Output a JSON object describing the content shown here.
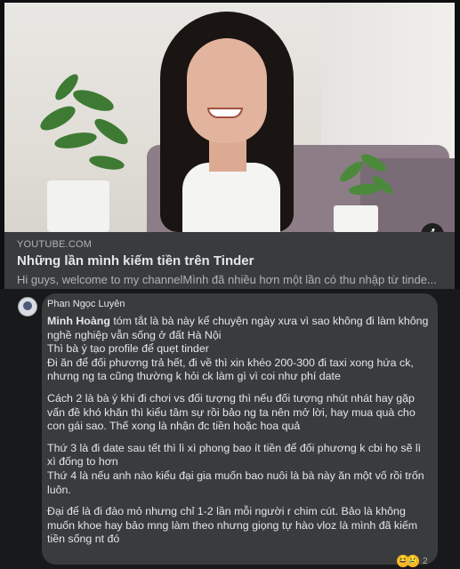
{
  "link_preview": {
    "domain": "YOUTUBE.COM",
    "title": "Những lần mình kiếm tiền trên Tinder",
    "description": "Hi guys, welcome to my channelMình đã nhiều hơn một lần có thu nhập từ tinde...",
    "info_icon": "info-icon"
  },
  "comment": {
    "author": "Phan Ngọc Luyên",
    "mention": "Minh Hoàng",
    "paragraphs": [
      {
        "first_line_rest": " tóm tắt là bà này kể chuyện ngày xưa vì sao không đi làm không nghề nghiệp vẫn sống ở đất Hà Nội",
        "lines": [
          "Thì bà ý tạo profile để quẹt tinder",
          "Đi ăn để đối phương trả hết, đi về thì xin khéo 200-300 đi taxi xong hứa ck, nhưng ng ta cũng thường k hỏi ck làm gì vì coi như phí date"
        ]
      },
      {
        "text": "Cách 2 là bà ý khi đi chơi vs đối tượng thì nếu đối tượng nhút nhát hay gặp vấn đề khó khăn thì kiểu tâm sự rồi bảo ng ta nên mở lời, hay mua quà cho con gái sao. Thế xong là nhận đc tiền hoặc hoa quả"
      },
      {
        "lines": [
          "Thứ 3 là đi date sau tết thì lì xì phong bao ít tiền để đối phương k cbi họ sẽ lì xì đống to hơn",
          "Thứ 4 là nếu anh nào kiểu đại gia muốn bao nuôi là bà này ăn một vố rồi trốn luôn."
        ]
      },
      {
        "text": "Đại để là đi đào mỏ nhưng chỉ 1-2 lần mỗi người r chim cút. Bảo là không muốn khoe hay bảo mng làm theo nhưng giọng tự hào vloz là mình đã kiếm tiền sống nt đó"
      }
    ],
    "reactions": {
      "icons": [
        "haha-icon",
        "sad-icon"
      ],
      "count": "2"
    }
  }
}
